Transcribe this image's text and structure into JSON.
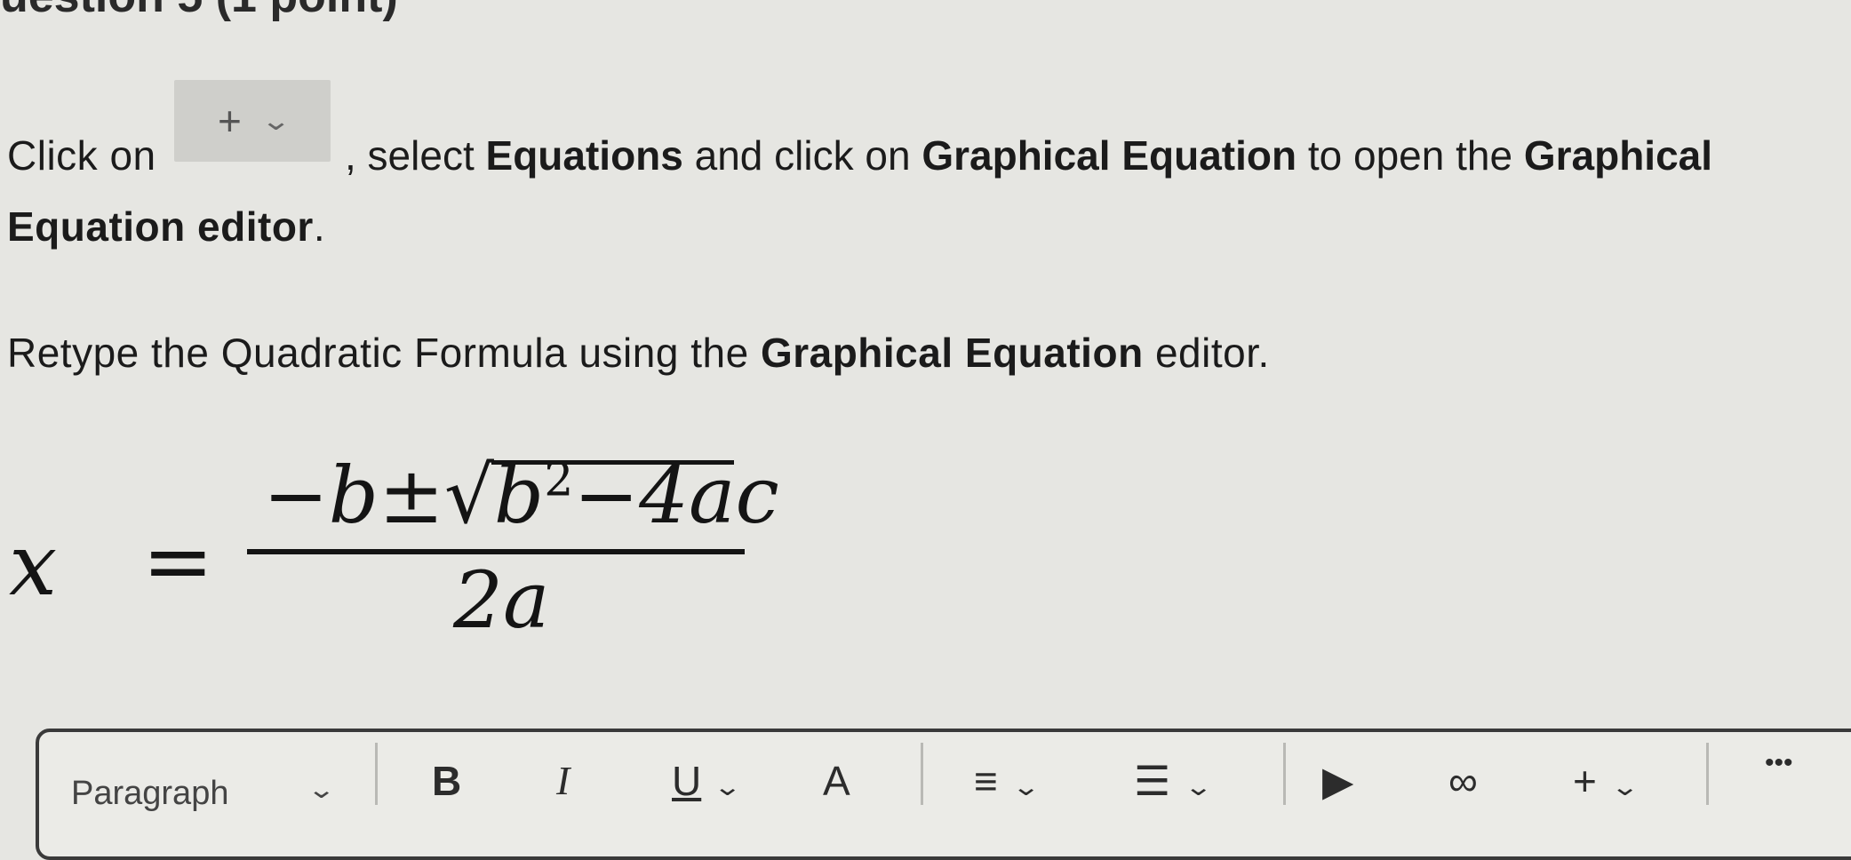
{
  "question_heading": "uestion 5 (1 point)",
  "instructions": {
    "line1_prefix": "Click on",
    "insert_button": {
      "plus": "+",
      "chevron": "⌄"
    },
    "line1_after_button": ", select ",
    "equations": "Equations",
    "and_click_on": " and click on ",
    "graphical_equation": "Graphical Equation",
    "to_open_the": " to open the ",
    "graphical": "Graphical",
    "equation_editor_bold": "Equation editor",
    "period": ".",
    "line3_prefix": "Retype the Quadratic Formula using the ",
    "line3_bold": "Graphical Equation",
    "line3_suffix": " editor."
  },
  "formula": {
    "lhs": "x",
    "equals": "=",
    "numerator_pre": "−b±",
    "radical": "√",
    "radicand_base": "b",
    "radicand_exp": "2",
    "radicand_rest": "−4ac",
    "denominator": "2a"
  },
  "toolbar": {
    "paragraph": "Paragraph",
    "bold": "B",
    "italic": "I",
    "underline": "U",
    "font_color": "A",
    "align": "≡",
    "list": "☰",
    "media": "▶",
    "link": "∞",
    "insert": "+",
    "more": "•••",
    "chevron": "⌄"
  }
}
